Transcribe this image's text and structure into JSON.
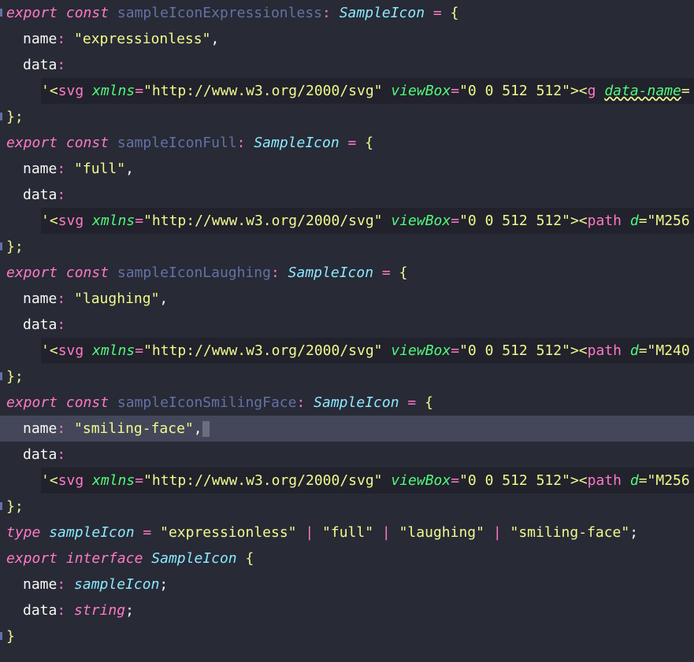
{
  "colors": {
    "background": "#282a36",
    "keyword": "#ff79c6",
    "identifier": "#6272a4",
    "type": "#8be9fd",
    "string": "#f1fa8c",
    "attribute": "#50fa7b",
    "current_line": "#44475a"
  },
  "editor": {
    "blocks": [
      {
        "kw_export": "export",
        "kw_const": "const",
        "const_name": "sampleIconExpressionless",
        "colon": ":",
        "type_name": "SampleIcon",
        "eq": "=",
        "open_brace": "{",
        "name_key": "name",
        "name_value": "\"expressionless\"",
        "comma": ",",
        "data_key": "data",
        "svg_open": "'<",
        "svg_tag": "svg",
        "xmlns_attr": "xmlns",
        "xmlns_val": "\"http://www.w3.org/2000/svg\"",
        "viewbox_attr": "viewBox",
        "viewbox_val": "\"0 0 512 512\"",
        "svg_close": ">",
        "child_open": "<",
        "child_tag": "g",
        "child_attr": "data-name",
        "child_rest": "=",
        "close": "};"
      },
      {
        "kw_export": "export",
        "kw_const": "const",
        "const_name": "sampleIconFull",
        "colon": ":",
        "type_name": "SampleIcon",
        "eq": "=",
        "open_brace": "{",
        "name_key": "name",
        "name_value": "\"full\"",
        "comma": ",",
        "data_key": "data",
        "svg_open": "'<",
        "svg_tag": "svg",
        "xmlns_attr": "xmlns",
        "xmlns_val": "\"http://www.w3.org/2000/svg\"",
        "viewbox_attr": "viewBox",
        "viewbox_val": "\"0 0 512 512\"",
        "svg_close": ">",
        "child_open": "<",
        "child_tag": "path",
        "child_attr": "d",
        "child_rest": "=\"M256",
        "close": "};"
      },
      {
        "kw_export": "export",
        "kw_const": "const",
        "const_name": "sampleIconLaughing",
        "colon": ":",
        "type_name": "SampleIcon",
        "eq": "=",
        "open_brace": "{",
        "name_key": "name",
        "name_value": "\"laughing\"",
        "comma": ",",
        "data_key": "data",
        "svg_open": "'<",
        "svg_tag": "svg",
        "xmlns_attr": "xmlns",
        "xmlns_val": "\"http://www.w3.org/2000/svg\"",
        "viewbox_attr": "viewBox",
        "viewbox_val": "\"0 0 512 512\"",
        "svg_close": ">",
        "child_open": "<",
        "child_tag": "path",
        "child_attr": "d",
        "child_rest": "=\"M240",
        "close": "};"
      },
      {
        "kw_export": "export",
        "kw_const": "const",
        "const_name": "sampleIconSmilingFace",
        "colon": ":",
        "type_name": "SampleIcon",
        "eq": "=",
        "open_brace": "{",
        "name_key": "name",
        "name_value": "\"smiling-face\"",
        "comma": ",",
        "data_key": "data",
        "svg_open": "'<",
        "svg_tag": "svg",
        "xmlns_attr": "xmlns",
        "xmlns_val": "\"http://www.w3.org/2000/svg\"",
        "viewbox_attr": "viewBox",
        "viewbox_val": "\"0 0 512 512\"",
        "svg_close": ">",
        "child_open": "<",
        "child_tag": "path",
        "child_attr": "d",
        "child_rest": "=\"M256",
        "close": "};"
      }
    ],
    "type_line": {
      "kw_type": "type",
      "alias": "sampleIcon",
      "eq": "=",
      "v1": "\"expressionless\"",
      "pipe": "|",
      "v2": "\"full\"",
      "v3": "\"laughing\"",
      "v4": "\"smiling-face\"",
      "semi": ";"
    },
    "interface": {
      "kw_export": "export",
      "kw_interface": "interface",
      "name": "SampleIcon",
      "open_brace": "{",
      "name_key": "name",
      "name_type": "sampleIcon",
      "data_key": "data",
      "data_type": "string",
      "colon": ":",
      "semi": ";",
      "close": "}"
    }
  }
}
